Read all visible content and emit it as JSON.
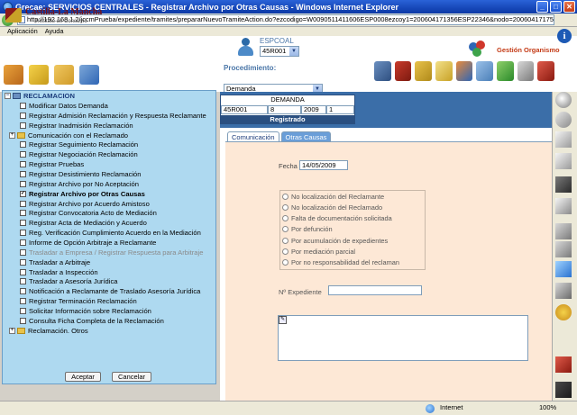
{
  "window": {
    "title": "Grecae: SERVICIOS CENTRALES - Registrar Archivo por Otras Causas - Windows Internet Explorer",
    "url": "http://192.168.1.2/jccmPrueba/expediente/tramites/prepararNuevoTramiteAction.do?ezcodigo=W0090511411606ESP0008ezcoy1=200604171356ESP22346&nodo=200604171758ESP99104#"
  },
  "menu": [
    "Aplicación",
    "Ayuda"
  ],
  "header": {
    "logo_name": "Castilla-La Mancha",
    "logo_sub": "Instituto de Consumo",
    "espcoal_label": "ESPCOAL",
    "espcoal_value": "45R001",
    "gestion_label": "Gestión Organismo",
    "procedimiento_label": "Procedimiento:",
    "procedimiento_value": "Demanda"
  },
  "demanda": {
    "title": "DEMANDA",
    "cells": [
      "45R001",
      "8",
      "2009",
      "1"
    ],
    "status": "Registrado"
  },
  "tabs": [
    {
      "label": "Comunicación",
      "active": false
    },
    {
      "label": "Otras Causas",
      "active": true
    }
  ],
  "form": {
    "fecha_label": "Fecha",
    "fecha_value": "14/05/2009",
    "radio_options": [
      "No localización del Reclamante",
      "No localización del Reclamado",
      "Falta de documentación solicitada",
      "Por defunción",
      "Por acumulación de expedientes",
      "Por mediación parcial",
      "Por no responsabilidad del reclaman"
    ],
    "expediente_label": "Nº Expediente",
    "expediente_value": ""
  },
  "tree": {
    "root": "RECLAMACION",
    "items": [
      {
        "label": "Modificar Datos Demanda",
        "type": "check"
      },
      {
        "label": "Registrar Admisión Reclamación y Respuesta Reclamante",
        "type": "check"
      },
      {
        "label": "Registrar Inadmisión Reclamación",
        "type": "check"
      },
      {
        "label": "Comunicación con el Reclamado",
        "type": "folder"
      },
      {
        "label": "Registrar Seguimiento Reclamación",
        "type": "check"
      },
      {
        "label": "Registrar Negociación Reclamación",
        "type": "check"
      },
      {
        "label": "Registrar Pruebas",
        "type": "check"
      },
      {
        "label": "Registrar Desistimiento Reclamación",
        "type": "check"
      },
      {
        "label": "Registrar Archivo por No Aceptación",
        "type": "check"
      },
      {
        "label": "Registrar Archivo por Otras Causas",
        "type": "check",
        "selected": true
      },
      {
        "label": "Registrar Archivo por Acuerdo Amistoso",
        "type": "check"
      },
      {
        "label": "Registrar Convocatoria Acto de Mediación",
        "type": "check"
      },
      {
        "label": "Registrar Acta de Mediación y Acuerdo",
        "type": "check"
      },
      {
        "label": "Reg. Verificación Cumplimiento Acuerdo en la Mediación",
        "type": "check"
      },
      {
        "label": "Informe de Opción Arbitraje a Reclamante",
        "type": "check"
      },
      {
        "label": "Trasladar a Empresa / Registrar Respuesta para Arbitraje",
        "type": "check",
        "disabled": true
      },
      {
        "label": "Trasladar a Arbitraje",
        "type": "check"
      },
      {
        "label": "Trasladar a Inspección",
        "type": "check"
      },
      {
        "label": "Trasladar a Asesoría Jurídica",
        "type": "check"
      },
      {
        "label": "Notificación a Reclamante de Traslado Asesoría Jurídica",
        "type": "check"
      },
      {
        "label": "Registrar Terminación Reclamación",
        "type": "check"
      },
      {
        "label": "Solicitar Información sobre Reclamación",
        "type": "check"
      },
      {
        "label": "Consulta Ficha Completa de la Reclamación",
        "type": "check"
      },
      {
        "label": "Reclamación. Otros",
        "type": "folder"
      }
    ],
    "accept_label": "Aceptar",
    "cancel_label": "Cancelar"
  },
  "status": {
    "zone": "Internet",
    "zoom": "100%"
  }
}
